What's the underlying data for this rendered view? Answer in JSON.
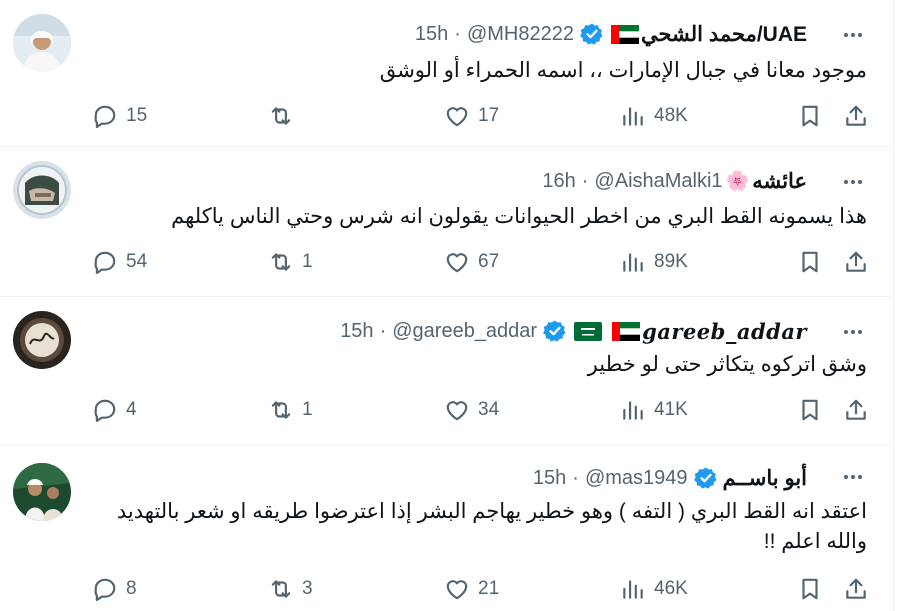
{
  "tweets": [
    {
      "display_name": "محمد الشحي/UAE",
      "flags": [
        "uae"
      ],
      "verified": true,
      "handle": "@MH82222",
      "time": "15h",
      "text_lines": [
        "موجود معانا في جبال الإمارات ،، اسمه الحمراء أو الوشق"
      ],
      "replies": "15",
      "reposts": "",
      "likes": "17",
      "views": "48K"
    },
    {
      "display_name": "عائشه",
      "emoji_badge": "🌸",
      "flags": [],
      "verified": false,
      "handle": "@AishaMalki1",
      "time": "16h",
      "text_lines": [
        "هذا يسمونه القط البري من اخطر الحيوانات يقولون انه شرس وحتي الناس ياكلهم"
      ],
      "replies": "54",
      "reposts": "1",
      "likes": "67",
      "views": "89K"
    },
    {
      "display_name": "gareeb_addar",
      "flags": [
        "uae",
        "ksa"
      ],
      "verified": true,
      "handle": "@gareeb_addar",
      "time": "15h",
      "text_lines": [
        "وشق اتركوه يتكاثر حتى لو خطير"
      ],
      "replies": "4",
      "reposts": "1",
      "likes": "34",
      "views": "41K"
    },
    {
      "display_name": "أبو باســم",
      "flags": [],
      "verified": true,
      "handle": "@mas1949",
      "time": "15h",
      "text_lines": [
        "اعتقد انه القط البري ( التفه ) وهو خطير يهاجم البشر إذا اعترضوا طريقه او شعر بالتهديد",
        "والله اعلم !!"
      ],
      "replies": "8",
      "reposts": "3",
      "likes": "21",
      "views": "46K"
    }
  ],
  "icons": {
    "reply": "reply-icon",
    "repost": "repost-icon",
    "like": "heart-icon",
    "views": "views-icon",
    "bookmark": "bookmark-icon",
    "share": "share-icon",
    "more": "more-icon",
    "verified": "verified-badge-icon"
  },
  "colors": {
    "text": "#0f1419",
    "muted": "#536471",
    "verified": "#1d9bf0",
    "divider": "#eff3f4"
  }
}
